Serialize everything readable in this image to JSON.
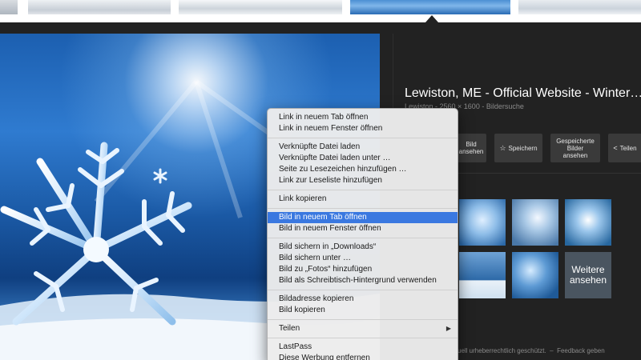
{
  "info": {
    "title": "Lewiston, ME - Official Website - Winter…",
    "meta": "Lewiston - 2560 × 1600 - Bildersuche",
    "actions": {
      "view_line1": "Bild",
      "view_line2": "ansehen",
      "save": "Speichern",
      "collect_line1": "Gespeicherte",
      "collect_line2": "Bilder",
      "collect_line3": "ansehen",
      "share": "Teilen"
    },
    "related_more_line1": "Weitere",
    "related_more_line2": "ansehen",
    "footer_text": "…uell urheberrechtlich geschützt.",
    "footer_link": "Feedback geben"
  },
  "context_menu": {
    "groups": [
      [
        "Link in neuem Tab öffnen",
        "Link in neuem Fenster öffnen"
      ],
      [
        "Verknüpfte Datei laden",
        "Verknüpfte Datei laden unter …",
        "Seite zu Lesezeichen hinzufügen …",
        "Link zur Leseliste hinzufügen"
      ],
      [
        "Link kopieren"
      ],
      [
        "Bild in neuem Tab öffnen",
        "Bild in neuem Fenster öffnen"
      ],
      [
        "Bild sichern in „Downloads“",
        "Bild sichern unter …",
        "Bild zu „Fotos“ hinzufügen",
        "Bild als Schreibtisch-Hintergrund verwenden"
      ],
      [
        "Bildadresse kopieren",
        "Bild kopieren"
      ],
      [
        "Teilen"
      ],
      [
        "LastPass",
        "Diese Werbung entfernen"
      ]
    ],
    "highlighted": "Bild in neuem Tab öffnen",
    "submenu_items": [
      "Teilen"
    ],
    "colors": {
      "highlight": "#3a78e0",
      "background": "#ececec"
    }
  },
  "icons": {
    "save": "star-icon",
    "share": "share-icon",
    "submenu": "triangle-right-icon"
  },
  "colors": {
    "page_bg": "#222222",
    "button_bg": "#3a3a3a"
  }
}
